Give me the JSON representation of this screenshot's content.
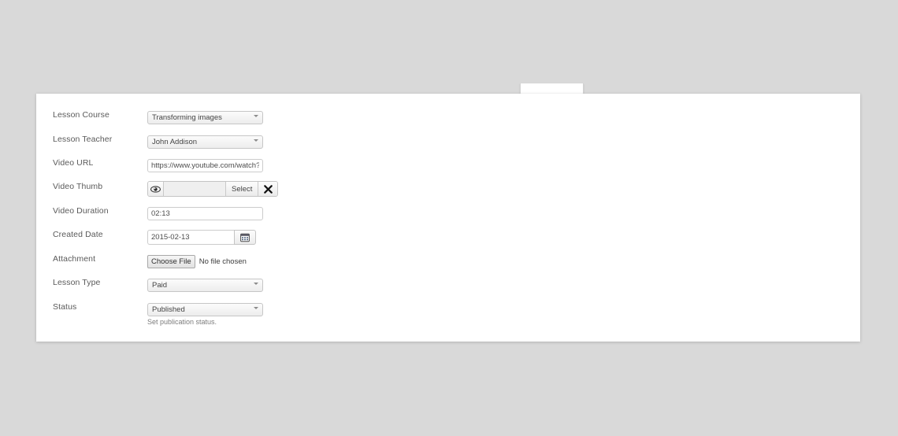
{
  "page": {
    "background_color": "#d9d9d9",
    "panel_color": "#ffffff"
  },
  "form": {
    "rows": [
      {
        "label": "Lesson Course",
        "type": "select",
        "value": "Transforming images",
        "options": [
          "Transforming images"
        ],
        "icon": "chevron-down-icon",
        "name": "lesson-course"
      },
      {
        "label": "Lesson Teacher",
        "type": "select",
        "value": "John Addison",
        "options": [
          "John Addison"
        ],
        "icon": "chevron-down-icon",
        "name": "lesson-teacher"
      },
      {
        "label": "Video URL",
        "type": "text",
        "value": "https://www.youtube.com/watch?v=",
        "placeholder": "",
        "name": "video-url"
      },
      {
        "label": "Video Thumb",
        "type": "media",
        "value": "",
        "placeholder": "",
        "eye_icon": "eye-icon",
        "select_label": "Select",
        "clear_icon": "close-x-icon",
        "name": "video-thumb"
      },
      {
        "label": "Video Duration",
        "type": "text",
        "value": "02:13",
        "placeholder": "",
        "name": "video-duration"
      },
      {
        "label": "Created Date",
        "type": "date",
        "value": "2015-02-13",
        "placeholder": "",
        "icon": "calendar-icon",
        "name": "created-date"
      },
      {
        "label": "Attachment",
        "type": "file",
        "button_label": "Choose File",
        "file_status": "No file chosen",
        "name": "attachment"
      },
      {
        "label": "Lesson Type",
        "type": "select",
        "value": "Paid",
        "options": [
          "Paid"
        ],
        "icon": "chevron-down-icon",
        "name": "lesson-type"
      },
      {
        "label": "Status",
        "type": "select",
        "value": "Published",
        "options": [
          "Published"
        ],
        "icon": "chevron-down-icon",
        "help": "Set publication status.",
        "name": "status"
      }
    ]
  }
}
